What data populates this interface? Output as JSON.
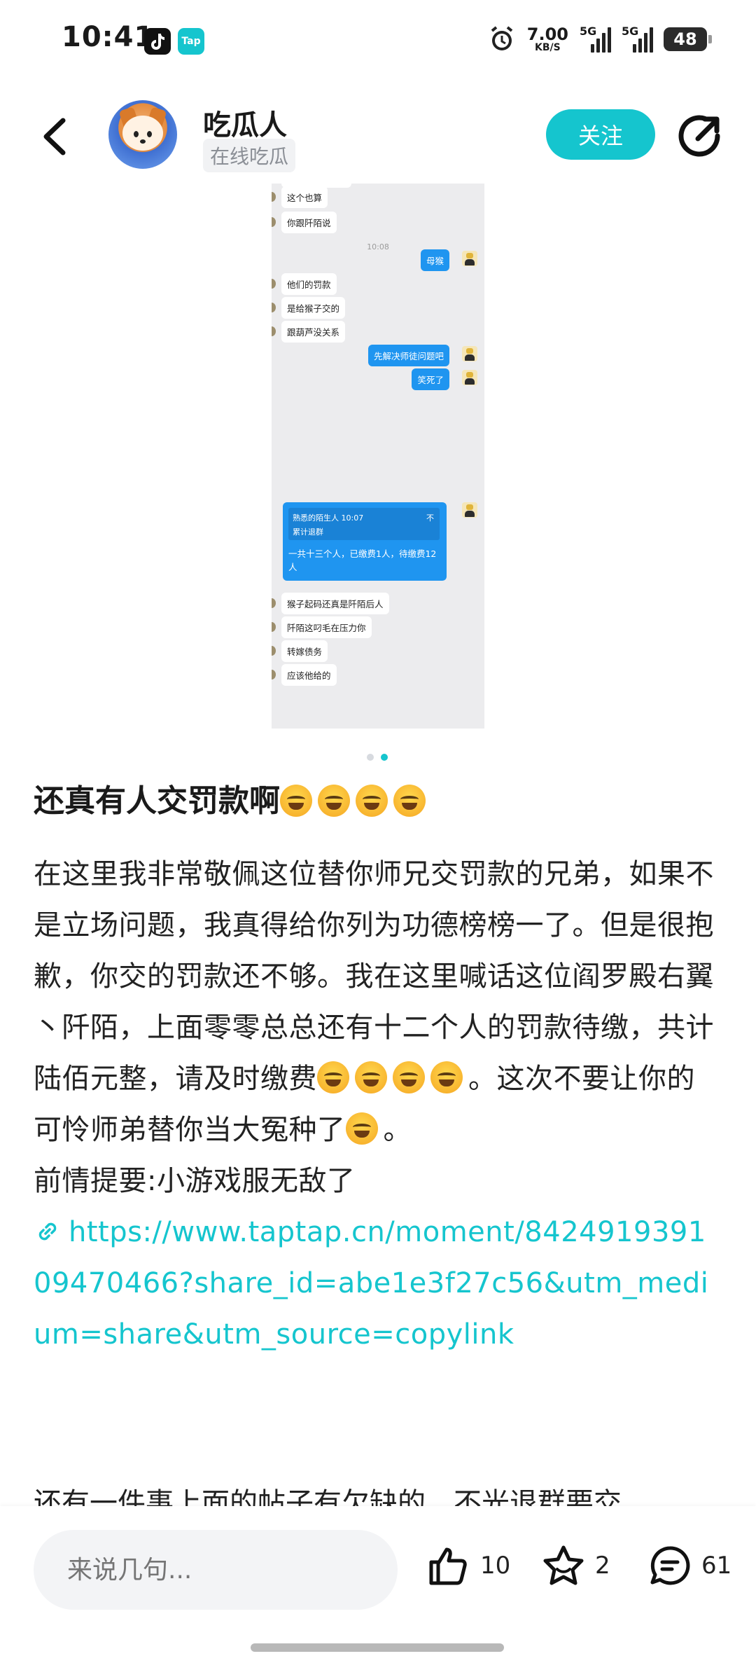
{
  "status_bar": {
    "time": "10:41",
    "apps": [
      "tiktok-icon",
      "taptap-icon"
    ],
    "taptap_label": "Tap",
    "net_speed_value": "7.00",
    "net_speed_unit": "KB/S",
    "signal_1": "5G",
    "signal_2": "5G",
    "battery": "48"
  },
  "header": {
    "username": "吃瓜人",
    "subtitle": "在线吃瓜",
    "follow_label": "关注"
  },
  "screenshot_chat": {
    "messages": [
      {
        "side": "left",
        "text": "这个也算"
      },
      {
        "side": "left",
        "text": "你跟阡陌说"
      },
      {
        "side": "time",
        "text": "10:08"
      },
      {
        "side": "right",
        "text": "母猴"
      },
      {
        "side": "left",
        "text": "他们的罚款"
      },
      {
        "side": "left",
        "text": "是给猴子交的"
      },
      {
        "side": "left",
        "text": "跟葫芦没关系"
      },
      {
        "side": "right",
        "text": "先解决师徒问题吧"
      },
      {
        "side": "right",
        "text": "笑死了"
      },
      {
        "side": "left",
        "text": "猴子起码还真是阡陌后人"
      },
      {
        "side": "left",
        "text": "阡陌这叼毛在压力你"
      },
      {
        "side": "left",
        "text": "转嫁债务"
      },
      {
        "side": "left",
        "text": "应该他给的"
      }
    ],
    "quote_card": {
      "quote_header": "熟悉的陌生人 10:07",
      "quote_close": "不",
      "quote_text": "累计退群",
      "message": "一共十三个人，已缴费1人，待缴费12人"
    }
  },
  "pager": {
    "count": 2,
    "active": 1
  },
  "post": {
    "title": "还真有人交罚款啊",
    "body_line_1": "在这里我非常敬佩这位替你师兄交罚款的兄弟，如果不是立场问题，我真得给你列为功德榜榜一了。但是很抱歉，你交的罚款还不够。我在这里喊话这位阎罗殿右翼丶阡陌，上面零零总总还有十二个人的罚款待缴，共计陆佰元整，请及时缴费",
    "body_line_2": "。这次不要让你的可怜师弟替你当大冤种了",
    "body_line_3": "。",
    "context_line": "前情提要:小游戏服无敌了",
    "link": "https://www.taptap.cn/moment/842491939109470466?share_id=abe1e3f27c56&utm_medium=share&utm_source=copylink",
    "cut_line": "还有一件事上面的帖子有欠缺的，不光退群要交"
  },
  "bottom_bar": {
    "comment_placeholder": "来说几句...",
    "like_count": "10",
    "favorite_count": "2",
    "comment_count": "61"
  }
}
